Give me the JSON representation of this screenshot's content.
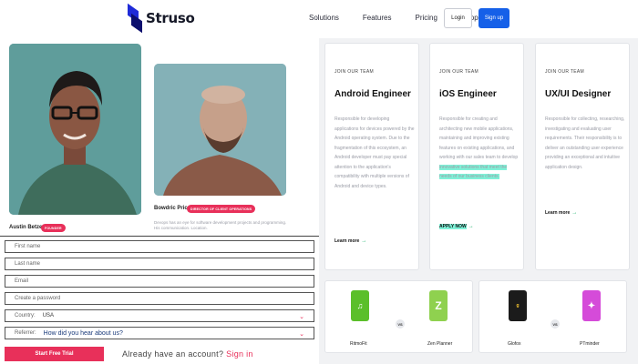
{
  "nav": {
    "logo_text": "Struso",
    "links": [
      "Solutions",
      "Features",
      "Pricing",
      "Support"
    ],
    "login": "Login",
    "signup": "Sign up"
  },
  "team": [
    {
      "name": "Austin Betzer",
      "role": "FOUNDER"
    },
    {
      "name": "Bowdric Price",
      "role": "DIRECTOR OF CLIENT OPERATIONS",
      "bio": "Devops has an eye for software development projects and programming. His communication. Location."
    }
  ],
  "form": {
    "first_name": "First name",
    "last_name": "Last name",
    "email": "Email",
    "password": "Create a password",
    "country_label": "Country:",
    "country_value": "USA",
    "referrer_label": "Referrer:",
    "referrer_question": "How did you hear about us?",
    "submit": "Start Free Trial",
    "already_text": "Already have an account?",
    "sign_in": "Sign in"
  },
  "jobs": [
    {
      "eyebrow": "JOIN OUR TEAM",
      "title": "Android Engineer",
      "description": "Responsible for developing applications for devices powered by the Android operating system. Due to the fragmentation of this ecosystem, an Android developer must pay special attention to the application's compatibility with multiple versions of Android and device types.",
      "learn_more": "Learn more"
    },
    {
      "eyebrow": "JOIN OUR TEAM",
      "title": "iOS Engineer",
      "description_main": "Responsible for creating and architecting new mobile applications, maintaining and improving existing features on existing applications, and working with our sales team to develop",
      "description_highlight": "innovative solutions that meet the needs of our business clients.",
      "apply": "APPLY NOW"
    },
    {
      "eyebrow": "JOIN OUR TEAM",
      "title": "UX/UI Designer",
      "description": "Responsible for collecting, researching, investigating and evaluating user requirements. Their responsibility is to deliver an outstanding user experience providing an exceptional and intuitive application design.",
      "learn_more": "Learn more"
    }
  ],
  "comparisons": [
    {
      "left": "RitmoFit",
      "right": "Zen Planner",
      "vs": "VS"
    },
    {
      "left": "Glofox",
      "right": "PTminder",
      "vs": "VS"
    }
  ],
  "colors": {
    "brand": "#1560e8",
    "accent": "#e8305a",
    "highlight": "#7ff2d8",
    "learn_arrow": "#17b26a"
  }
}
